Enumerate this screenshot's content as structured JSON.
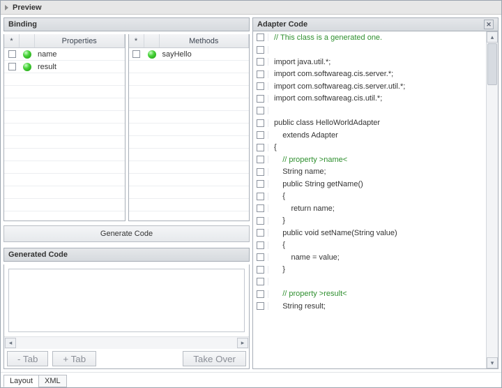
{
  "window": {
    "title": "Preview"
  },
  "binding": {
    "title": "Binding",
    "properties": {
      "header_star": "*",
      "header_label": "Properties",
      "rows": [
        {
          "label": "name"
        },
        {
          "label": "result"
        }
      ]
    },
    "methods": {
      "header_star": "*",
      "header_label": "Methods",
      "rows": [
        {
          "label": "sayHello"
        }
      ]
    },
    "generate_button": "Generate Code"
  },
  "generated": {
    "title": "Generated Code",
    "text": "",
    "buttons": {
      "minus_tab": "- Tab",
      "plus_tab": "+ Tab",
      "take_over": "Take Over"
    }
  },
  "adapter": {
    "title": "Adapter Code",
    "lines": [
      {
        "text": "// This class is a generated one.",
        "comment": true
      },
      {
        "text": ""
      },
      {
        "text": "import java.util.*;"
      },
      {
        "text": "import com.softwareag.cis.server.*;"
      },
      {
        "text": "import com.softwareag.cis.server.util.*;"
      },
      {
        "text": "import com.softwareag.cis.util.*;"
      },
      {
        "text": ""
      },
      {
        "text": "public class HelloWorldAdapter"
      },
      {
        "text": "    extends Adapter"
      },
      {
        "text": "{"
      },
      {
        "text": "    // property >name<",
        "comment": true
      },
      {
        "text": "    String name;"
      },
      {
        "text": "    public String getName()"
      },
      {
        "text": "    {"
      },
      {
        "text": "        return name;"
      },
      {
        "text": "    }"
      },
      {
        "text": "    public void setName(String value)"
      },
      {
        "text": "    {"
      },
      {
        "text": "        name = value;"
      },
      {
        "text": "    }"
      },
      {
        "text": ""
      },
      {
        "text": "    // property >result<",
        "comment": true
      },
      {
        "text": "    String result;"
      }
    ]
  },
  "tabs": {
    "layout": "Layout",
    "xml": "XML"
  }
}
